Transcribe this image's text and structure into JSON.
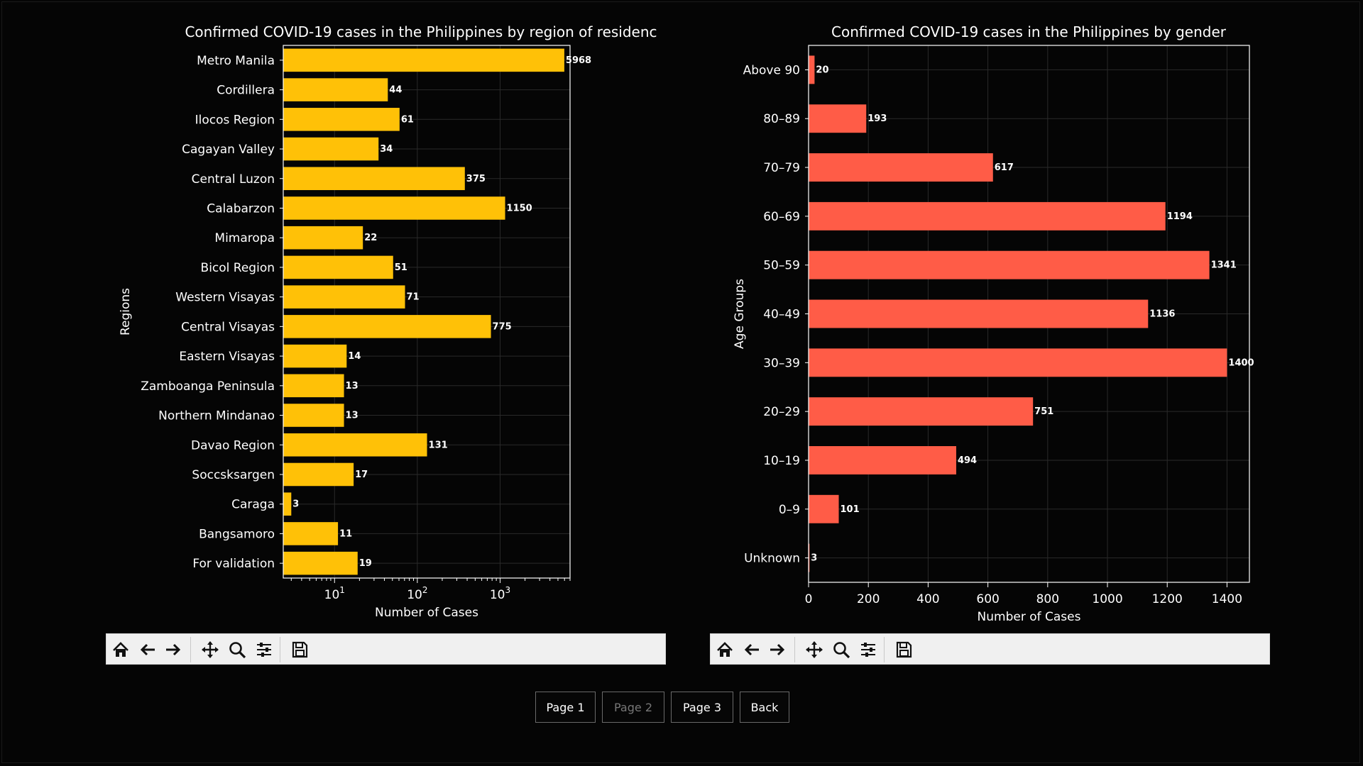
{
  "chart_data": [
    {
      "type": "bar",
      "orientation": "horizontal",
      "title": "Confirmed COVID-19 cases in the Philippines by region of residenc",
      "xlabel": "Number of Cases",
      "ylabel": "Regions",
      "xscale": "log",
      "xlim": [
        2.4,
        7000
      ],
      "xticks": [
        10,
        100,
        1000
      ],
      "xtick_labels": [
        {
          "base": "10",
          "exp": "1"
        },
        {
          "base": "10",
          "exp": "2"
        },
        {
          "base": "10",
          "exp": "3"
        }
      ],
      "categories": [
        "Metro Manila",
        "Cordillera",
        "Ilocos Region",
        "Cagayan Valley",
        "Central Luzon",
        "Calabarzon",
        "Mimaropa",
        "Bicol Region",
        "Western Visayas",
        "Central Visayas",
        "Eastern Visayas",
        "Zamboanga Peninsula",
        "Northern Mindanao",
        "Davao Region",
        "Soccsksargen",
        "Caraga",
        "Bangsamoro",
        "For validation"
      ],
      "values": [
        5968,
        44,
        61,
        34,
        375,
        1150,
        22,
        51,
        71,
        775,
        14,
        13,
        13,
        131,
        17,
        3,
        11,
        19
      ],
      "value_labels": [
        "5968",
        "44",
        "61",
        "34",
        "375",
        "1150",
        "22",
        "51",
        "71",
        "775",
        "14",
        "13",
        "13",
        "131",
        "17",
        "3",
        "11",
        "19"
      ],
      "color": "#ffc107",
      "grid": true
    },
    {
      "type": "bar",
      "orientation": "horizontal",
      "title": "Confirmed COVID-19 cases in the Philippines by gender",
      "xlabel": "Number of Cases",
      "ylabel": "Age Groups",
      "xscale": "linear",
      "xlim": [
        0,
        1475
      ],
      "xticks": [
        0,
        200,
        400,
        600,
        800,
        1000,
        1200,
        1400
      ],
      "xtick_labels": [
        "0",
        "200",
        "400",
        "600",
        "800",
        "1000",
        "1200",
        "1400"
      ],
      "categories": [
        "Above 90",
        "80–89",
        "70–79",
        "60–69",
        "50–59",
        "40–49",
        "30–39",
        "20–29",
        "10–19",
        "0–9",
        "Unknown"
      ],
      "values": [
        20,
        193,
        617,
        1194,
        1341,
        1136,
        1400,
        751,
        494,
        101,
        3
      ],
      "value_labels": [
        "20",
        "193",
        "617",
        "1194",
        "1341",
        "1136",
        "1400",
        "751",
        "494",
        "101",
        "3"
      ],
      "color": "#ff5c47",
      "grid": true
    }
  ],
  "toolbar": {
    "buttons": [
      "home-icon",
      "back-arrow-icon",
      "forward-arrow-icon",
      "pan-icon",
      "zoom-icon",
      "configure-subplots-icon",
      "save-icon"
    ]
  },
  "pager": {
    "page1": "Page 1",
    "page2": "Page 2",
    "page3": "Page 3",
    "back": "Back"
  }
}
